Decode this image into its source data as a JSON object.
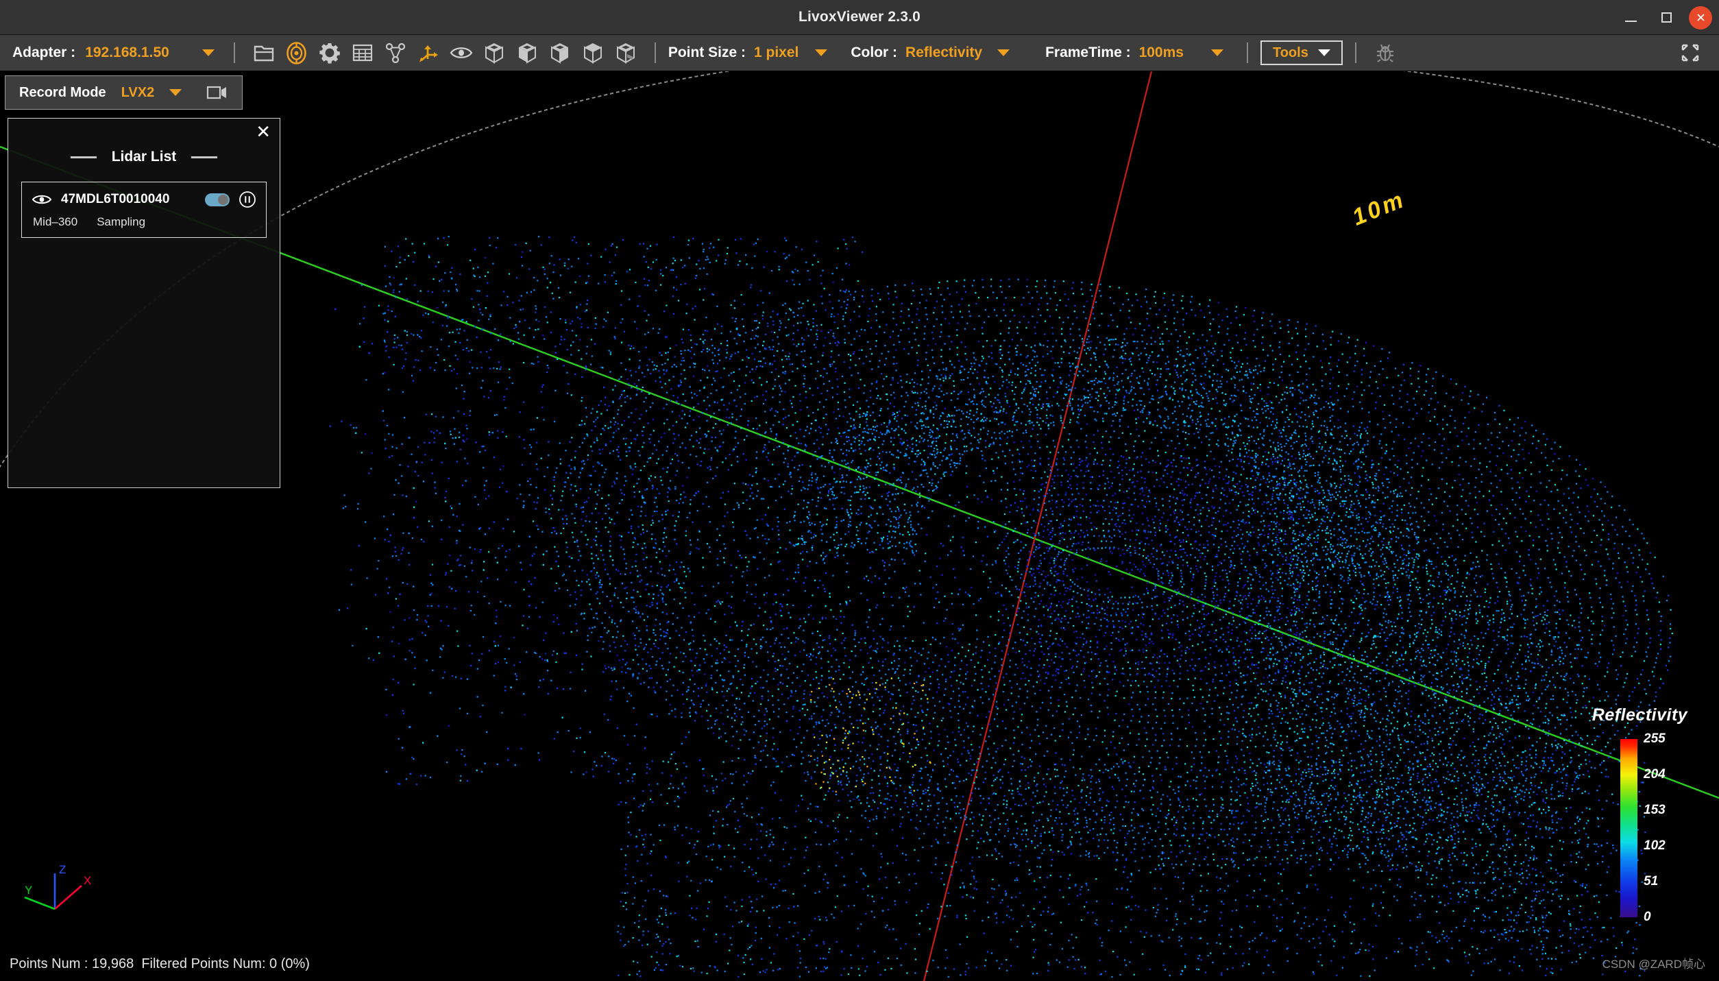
{
  "window": {
    "title": "LivoxViewer 2.3.0",
    "minimize_label": "–",
    "maximize_label": "□",
    "close_label": "✕"
  },
  "toolbar": {
    "adapter_label": "Adapter :",
    "adapter_value": "192.168.1.50",
    "icons": [
      {
        "name": "open-file-icon"
      },
      {
        "name": "lidar-target-icon"
      },
      {
        "name": "settings-gear-icon"
      },
      {
        "name": "grid-table-icon"
      },
      {
        "name": "network-graph-icon"
      },
      {
        "name": "axes-transform-icon"
      },
      {
        "name": "eye-visibility-icon"
      },
      {
        "name": "cube-view-iso-icon"
      },
      {
        "name": "cube-view-front-icon"
      },
      {
        "name": "cube-view-left-icon"
      },
      {
        "name": "cube-view-top-icon"
      },
      {
        "name": "cube-view-right-icon"
      }
    ],
    "point_size_label": "Point Size :",
    "point_size_value": "1 pixel",
    "color_label": "Color :",
    "color_value": "Reflectivity",
    "frametime_label": "FrameTime :",
    "frametime_value": "100ms",
    "tools_label": "Tools",
    "debug_icon": "bug-debug-icon",
    "fullscreen_icon": "fullscreen-expand-icon",
    "accent_color": "#f0a020"
  },
  "record_bar": {
    "label": "Record Mode",
    "format_value": "LVX2",
    "record_icon": "camera-record-icon"
  },
  "lidar_panel": {
    "title": "Lidar List",
    "close_label": "✕",
    "items": [
      {
        "serial": "47MDL6T0010040",
        "model": "Mid–360",
        "status": "Sampling",
        "visible": true,
        "toggle_on": true
      }
    ]
  },
  "viewport": {
    "distance_label": "10m",
    "distance_label_color": "#ffd21e",
    "axis_x_label": "X",
    "axis_y_label": "Y",
    "axis_z_label": "Z",
    "axis_x_color": "#ff0033",
    "axis_y_color": "#00d51e",
    "axis_z_color": "#2a55ff"
  },
  "legend": {
    "title": "Reflectivity",
    "ticks": [
      "255",
      "204",
      "153",
      "102",
      "51",
      "0"
    ]
  },
  "status": {
    "text": "Points Num : 19,968  Filtered Points Num: 0 (0%)",
    "points_num": "19,968",
    "filtered_points_num": "0",
    "filtered_percent": "0%"
  },
  "watermark": {
    "text": "CSDN @ZARD帧心"
  },
  "chart_data": {
    "type": "scatter",
    "title": "Livox Mid-360 point cloud — colored by Reflectivity",
    "colormap": [
      "#3a0e8c",
      "#1a15c8",
      "#0f3ce8",
      "#0a86f5",
      "#0ddbe8",
      "#11e08a",
      "#2ee02e",
      "#9ae80f",
      "#f3f30a",
      "#ffa800",
      "#ff2a00",
      "#ff0000"
    ],
    "value_range": [
      0,
      255
    ],
    "tick_values": [
      0,
      51,
      102,
      153,
      204,
      255
    ],
    "total_points": 19968,
    "filtered_points": 0,
    "range_ring_radius_m": 10
  }
}
